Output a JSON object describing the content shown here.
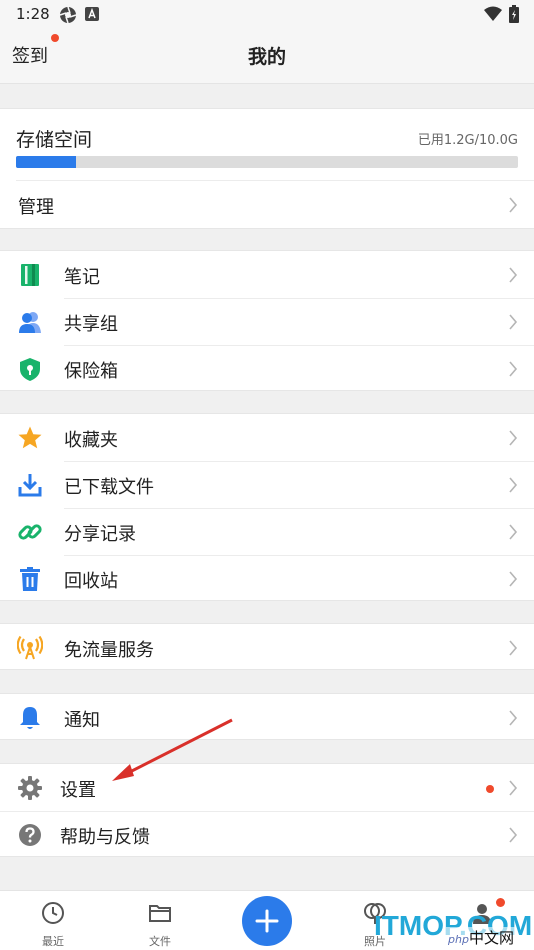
{
  "status_bar": {
    "time": "1:28"
  },
  "header": {
    "checkin": "签到",
    "title": "我的"
  },
  "storage": {
    "title": "存储空间",
    "used_text": "已用1.2G/10.0G",
    "used_fraction": 0.12,
    "manage_label": "管理"
  },
  "groups": [
    [
      {
        "label": "笔记",
        "icon": "notebook-icon"
      },
      {
        "label": "共享组",
        "icon": "users-icon"
      },
      {
        "label": "保险箱",
        "icon": "shield-lock-icon"
      }
    ],
    [
      {
        "label": "收藏夹",
        "icon": "star-icon"
      },
      {
        "label": "已下载文件",
        "icon": "download-icon"
      },
      {
        "label": "分享记录",
        "icon": "link-icon"
      },
      {
        "label": "回收站",
        "icon": "trash-icon"
      }
    ],
    [
      {
        "label": "免流量服务",
        "icon": "antenna-icon"
      }
    ],
    [
      {
        "label": "通知",
        "icon": "bell-icon"
      }
    ],
    [
      {
        "label": "设置",
        "icon": "gear-icon",
        "badge": true
      },
      {
        "label": "帮助与反馈",
        "icon": "help-icon"
      }
    ]
  ],
  "tabs": [
    {
      "label": "最近",
      "icon": "clock-icon"
    },
    {
      "label": "文件",
      "icon": "folder-icon"
    },
    {
      "label": "照片",
      "icon": "photos-icon"
    }
  ],
  "watermark": {
    "main": "ITMOP.COM",
    "php": "php",
    "cn": "中文网"
  },
  "colors": {
    "accent": "#2b7bea",
    "badge": "#f04a2c",
    "green": "#19b36b",
    "orange": "#f6a623",
    "gray": "#777777"
  }
}
